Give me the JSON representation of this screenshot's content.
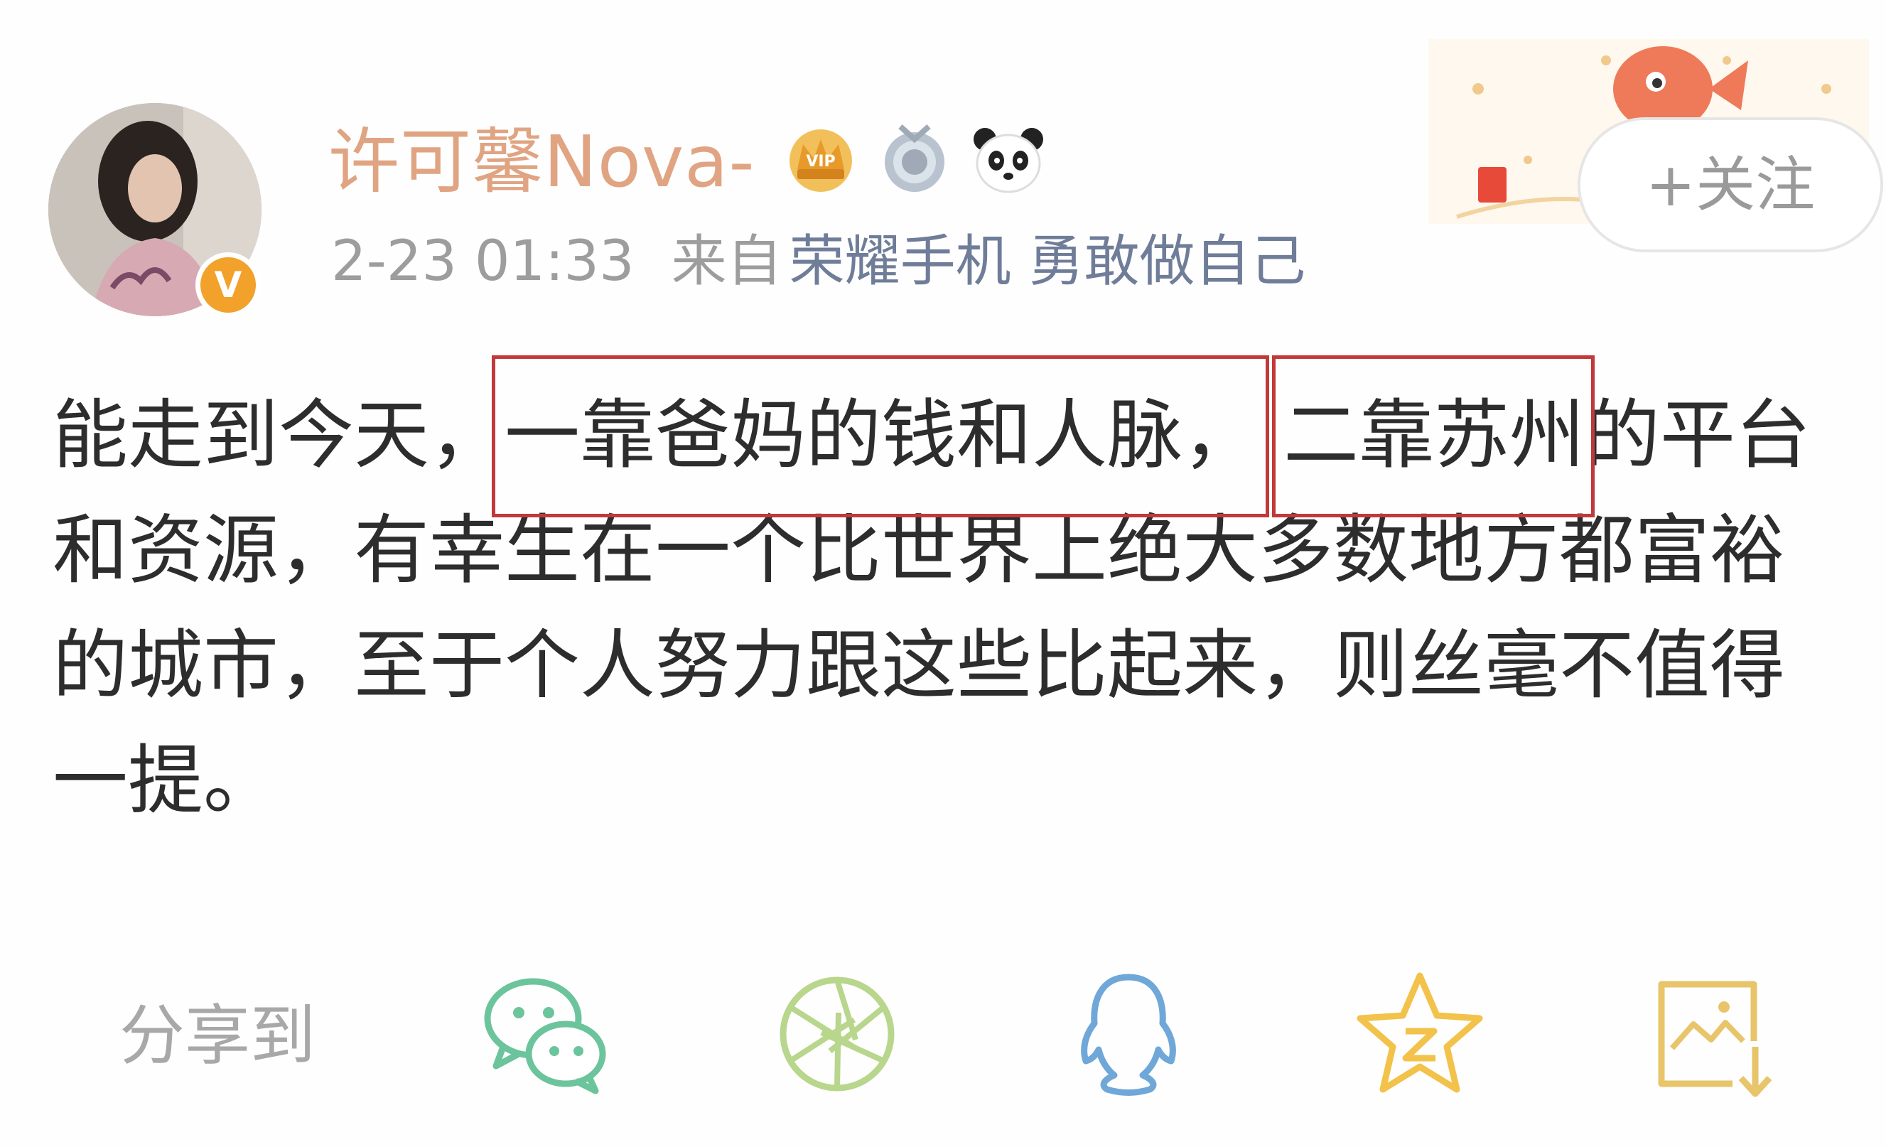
{
  "post": {
    "author": {
      "name": "许可馨Nova-",
      "avatar_icon": "avatar-photo",
      "verified_badge": "V",
      "badges": [
        "crown-icon",
        "medal-icon",
        "panda-icon"
      ]
    },
    "meta": {
      "time": "2-23 01:33",
      "source_prefix": "来自",
      "device": "荣耀手机 勇敢做自己"
    },
    "follow_button": "+关注",
    "body": {
      "line1_a": "能走到今天，",
      "line1_h1": "一靠爸妈的钱和人脉，",
      "line1_h2": "二靠苏州",
      "line1_b": "的平台",
      "line2": "和资源，有幸生在一个比世界上绝大多数地方都富裕",
      "line3": "的城市，至于个人努力跟这些比起来，则丝毫不值得",
      "line4": "一提。"
    },
    "share": {
      "label": "分享到",
      "icons": [
        "wechat-icon",
        "moments-icon",
        "qq-icon",
        "qzone-icon",
        "save-image-icon"
      ]
    }
  },
  "colors": {
    "username": "#e0a483",
    "meta_gray": "#9d9d9d",
    "device_blue": "#6f7d99",
    "highlight_red": "#c2393a",
    "body_text": "#2d2d2d",
    "wechat_green": "#6cc49c",
    "moments_green": "#b8d68c",
    "qq_blue": "#6fa8d8",
    "qzone_yellow": "#f2c24a",
    "save_yellow": "#e8c46a"
  }
}
